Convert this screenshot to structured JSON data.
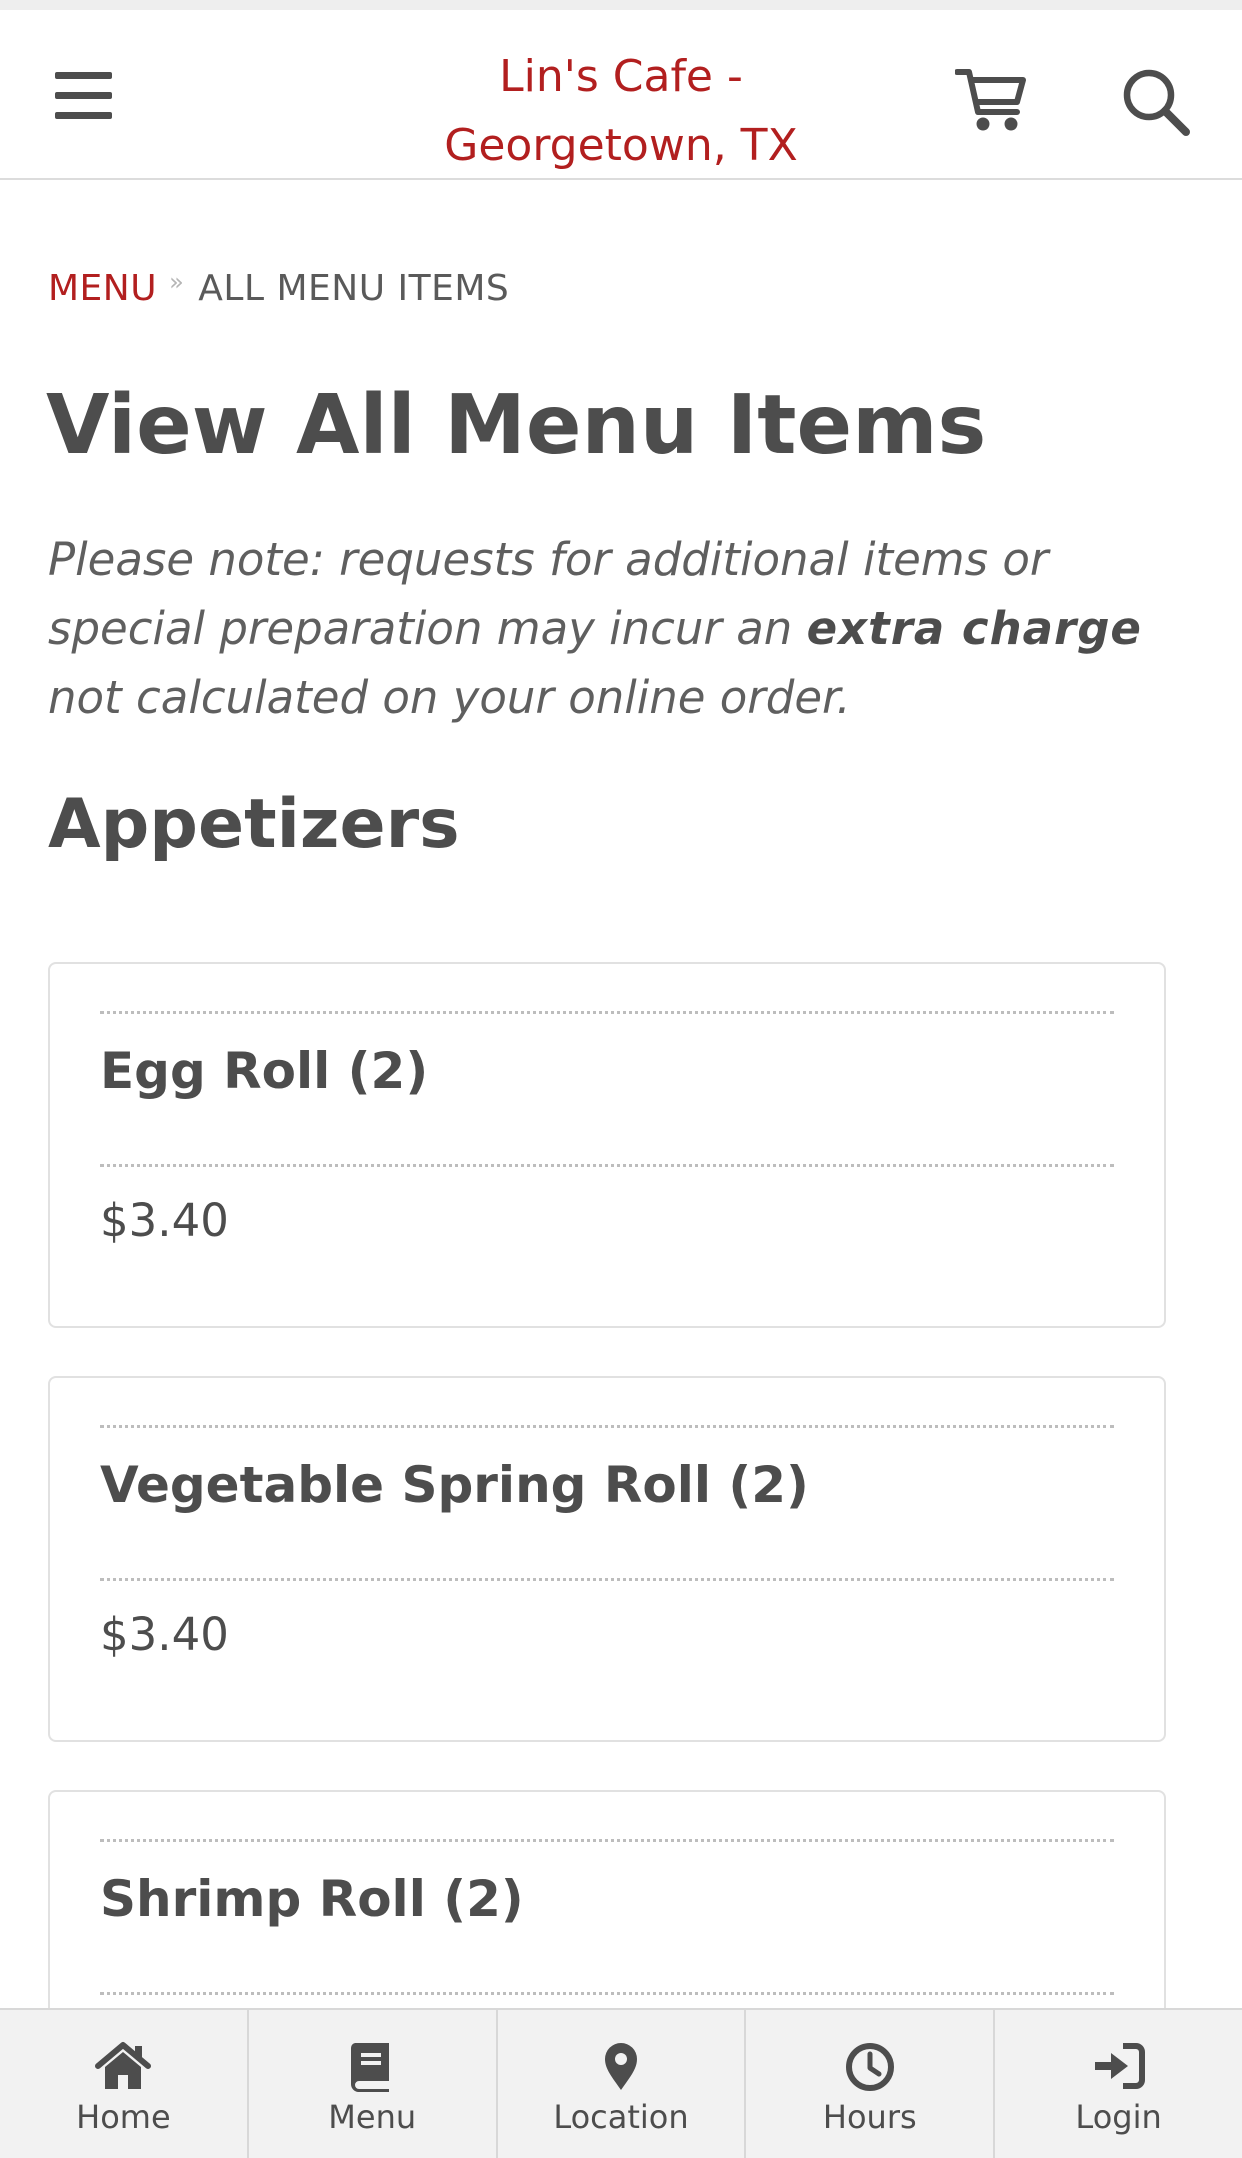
{
  "header": {
    "brand_line1": "Lin's Cafe -",
    "brand_line2": "Georgetown, TX",
    "icons": {
      "menu": "hamburger-icon",
      "cart": "cart-icon",
      "search": "search-icon"
    }
  },
  "breadcrumb": {
    "root": "MENU",
    "separator": "»",
    "current": "ALL MENU ITEMS"
  },
  "page": {
    "title": "View All Menu Items",
    "note_before": "Please note: requests for additional items or special preparation may incur an ",
    "note_emphasis": "extra charge",
    "note_after": " not calculated on your online order."
  },
  "section": {
    "title": "Appetizers",
    "items": [
      {
        "name": "Egg Roll (2)",
        "price": "$3.40"
      },
      {
        "name": "Vegetable Spring Roll (2)",
        "price": "$3.40"
      },
      {
        "name": "Shrimp Roll (2)",
        "price": ""
      }
    ]
  },
  "bottom_nav": [
    {
      "label": "Home",
      "icon": "home-icon"
    },
    {
      "label": "Menu",
      "icon": "book-icon"
    },
    {
      "label": "Location",
      "icon": "map-pin-icon"
    },
    {
      "label": "Hours",
      "icon": "clock-icon"
    },
    {
      "label": "Login",
      "icon": "sign-in-icon"
    }
  ],
  "colors": {
    "accent": "#b21f1f",
    "text": "#4d4d4d",
    "nav_background": "#f2f2f2",
    "card_border": "#e1e1e1"
  }
}
